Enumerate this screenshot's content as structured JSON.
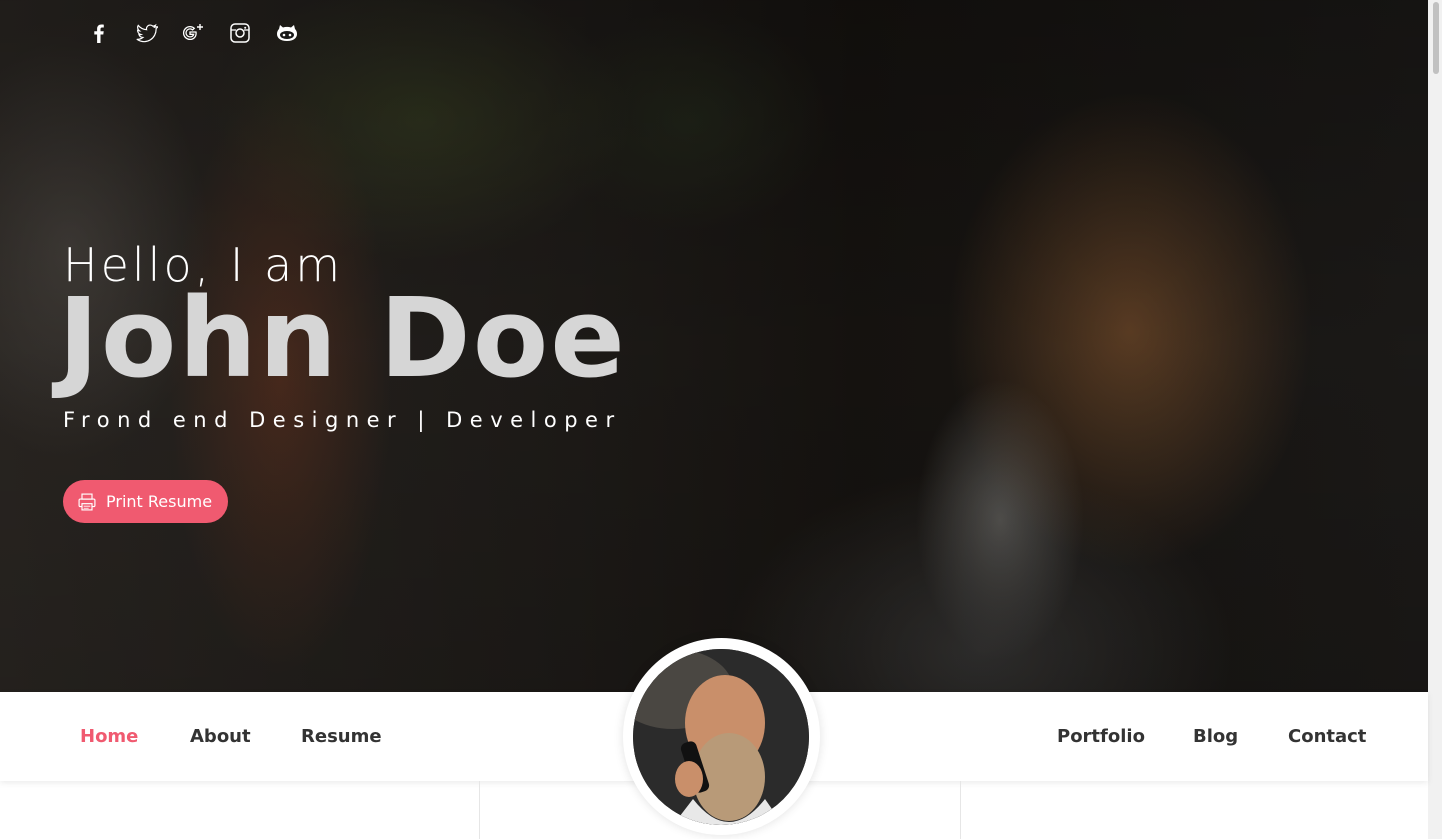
{
  "social": [
    {
      "name": "facebook-icon"
    },
    {
      "name": "twitter-icon"
    },
    {
      "name": "google-plus-icon"
    },
    {
      "name": "instagram-icon"
    },
    {
      "name": "github-icon"
    }
  ],
  "hero": {
    "greeting": "Hello, I am",
    "name": "John Doe",
    "tagline": "Frond end Designer | Developer",
    "print_button": "Print Resume",
    "print_icon": "printer-icon"
  },
  "nav": {
    "left": [
      "Home",
      "About",
      "Resume"
    ],
    "right": [
      "Portfolio",
      "Blog",
      "Contact"
    ],
    "active": "Home"
  },
  "colors": {
    "accent": "#f05a70",
    "nav_text": "#333333"
  }
}
